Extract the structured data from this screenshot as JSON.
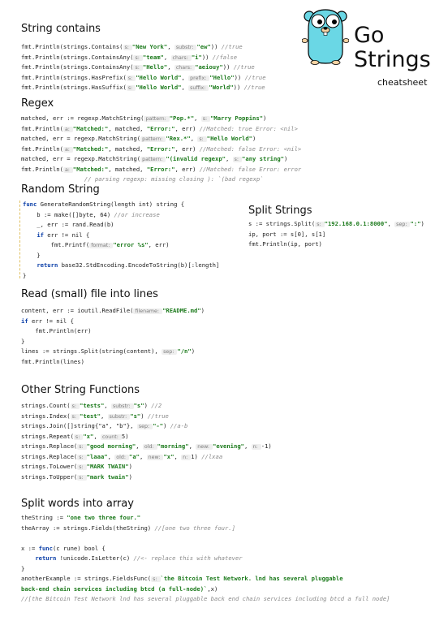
{
  "header": {
    "title_line1": "Go",
    "title_line2": "Strings",
    "subtitle": "cheatsheet"
  },
  "sections": {
    "contains": "String contains",
    "regex": "Regex",
    "random": "Random String",
    "split": "Split Strings",
    "readfile": "Read (small) file into lines",
    "other": "Other String Functions",
    "words": "Split words into array"
  },
  "colors": {
    "string": "#1c7a1c",
    "comment": "#8a8a8a",
    "keyword": "#0b3fa8",
    "hint_bg": "#efefef",
    "gopher": "#6ad7e5"
  },
  "icons": {
    "logo": "gopher-icon"
  },
  "code": {
    "contains": [
      [
        [
          "fmt.Println(strings.Contains(",
          ""
        ],
        [
          "s: ",
          "h"
        ],
        [
          "\"New York\"",
          "s"
        ],
        [
          ", ",
          ""
        ],
        [
          "substr: ",
          "h"
        ],
        [
          "\"ew\"",
          "s"
        ],
        [
          ")) ",
          ""
        ],
        [
          "//true",
          "c"
        ]
      ],
      [
        [
          "fmt.Println(strings.ContainsAny(",
          ""
        ],
        [
          "s: ",
          "h"
        ],
        [
          "\"team\"",
          "s"
        ],
        [
          ", ",
          ""
        ],
        [
          "chars: ",
          "h"
        ],
        [
          "\"i\"",
          "s"
        ],
        [
          ")) ",
          ""
        ],
        [
          "//false",
          "c"
        ]
      ],
      [
        [
          "fmt.Println(strings.ContainsAny(",
          ""
        ],
        [
          "s: ",
          "h"
        ],
        [
          "\"Hello\"",
          "s"
        ],
        [
          ", ",
          ""
        ],
        [
          "chars: ",
          "h"
        ],
        [
          "\"aeiouy\"",
          "s"
        ],
        [
          ")) ",
          ""
        ],
        [
          "//true",
          "c"
        ]
      ],
      [
        [
          "fmt.Println(strings.HasPrefix(",
          ""
        ],
        [
          "s: ",
          "h"
        ],
        [
          "\"Hello World\"",
          "s"
        ],
        [
          ", ",
          ""
        ],
        [
          "prefix: ",
          "h"
        ],
        [
          "\"Hello\"",
          "s"
        ],
        [
          ")) ",
          ""
        ],
        [
          "//true",
          "c"
        ]
      ],
      [
        [
          "fmt.Println(strings.HasSuffix(",
          ""
        ],
        [
          "s: ",
          "h"
        ],
        [
          "\"Hello World\"",
          "s"
        ],
        [
          ", ",
          ""
        ],
        [
          "suffix: ",
          "h"
        ],
        [
          "\"World\"",
          "s"
        ],
        [
          ")) ",
          ""
        ],
        [
          "//true",
          "c"
        ]
      ]
    ],
    "regex": [
      [
        [
          "matched, err := regexp.MatchString(",
          ""
        ],
        [
          "pattern: ",
          "h"
        ],
        [
          "\"Pop.*\"",
          "s"
        ],
        [
          ", ",
          ""
        ],
        [
          "s: ",
          "h"
        ],
        [
          "\"Marry Poppins\"",
          "s"
        ],
        [
          ")",
          ""
        ]
      ],
      [
        [
          "fmt.Println(",
          ""
        ],
        [
          "a: ",
          "h"
        ],
        [
          "\"Matched:\"",
          "s"
        ],
        [
          ", matched, ",
          ""
        ],
        [
          "\"Error:\"",
          "s"
        ],
        [
          ", err) ",
          ""
        ],
        [
          "//Matched: true Error: <nil>",
          "c"
        ]
      ],
      [
        [
          "matched, err = regexp.MatchString(",
          ""
        ],
        [
          "pattern: ",
          "h"
        ],
        [
          "\"Rex.*\"",
          "s"
        ],
        [
          ", ",
          ""
        ],
        [
          "s: ",
          "h"
        ],
        [
          "\"Hello World\"",
          "s"
        ],
        [
          ")",
          ""
        ]
      ],
      [
        [
          "fmt.Println(",
          ""
        ],
        [
          "a: ",
          "h"
        ],
        [
          "\"Matched:\"",
          "s"
        ],
        [
          ", matched, ",
          ""
        ],
        [
          "\"Error:\"",
          "s"
        ],
        [
          ", err) ",
          ""
        ],
        [
          "//Matched: false Error: <nil>",
          "c"
        ]
      ],
      [
        [
          "matched, err = regexp.MatchString(",
          ""
        ],
        [
          "pattern: ",
          "h"
        ],
        [
          "\"(invalid regexp\"",
          "s"
        ],
        [
          ", ",
          ""
        ],
        [
          "s: ",
          "h"
        ],
        [
          "\"any string\"",
          "s"
        ],
        [
          ")",
          ""
        ]
      ],
      [
        [
          "fmt.Println(",
          ""
        ],
        [
          "a: ",
          "h"
        ],
        [
          "\"Matched:\"",
          "s"
        ],
        [
          ", matched, ",
          ""
        ],
        [
          "\"Error:\"",
          "s"
        ],
        [
          ", err) ",
          ""
        ],
        [
          "//Matched: false Error: error",
          "c"
        ]
      ],
      [
        [
          "                  ",
          ""
        ],
        [
          "// parsing regexp: missing closing ): `(bad regexp`",
          "c"
        ]
      ]
    ],
    "random": [
      [
        [
          "func",
          "k"
        ],
        [
          " GenerateRandomString(length int) string {",
          ""
        ]
      ],
      [
        [
          "    b := make([]byte, 64) ",
          ""
        ],
        [
          "//or increase",
          "c"
        ]
      ],
      [
        [
          "    _, err := rand.Read(b)",
          ""
        ]
      ],
      [
        [
          "    ",
          ""
        ],
        [
          "if",
          "k"
        ],
        [
          " err != nil {",
          ""
        ]
      ],
      [
        [
          "        fmt.Printf(",
          ""
        ],
        [
          "format: ",
          "h"
        ],
        [
          "\"error %s\"",
          "s"
        ],
        [
          ", err)",
          ""
        ]
      ],
      [
        [
          "    }",
          ""
        ]
      ],
      [
        [
          "    ",
          ""
        ],
        [
          "return",
          "k"
        ],
        [
          " base32.StdEncoding.EncodeToString(b)[:length]",
          ""
        ]
      ],
      [
        [
          "}",
          ""
        ]
      ]
    ],
    "split": [
      [
        [
          "s := strings.Split(",
          ""
        ],
        [
          "s: ",
          "h"
        ],
        [
          "\"192.168.0.1:8000\"",
          "s"
        ],
        [
          ", ",
          ""
        ],
        [
          "sep: ",
          "h"
        ],
        [
          "\":\"",
          "s"
        ],
        [
          ")",
          ""
        ]
      ],
      [
        [
          "ip, port := s[0], s[1]",
          ""
        ]
      ],
      [
        [
          "fmt.Println(ip, port)",
          ""
        ]
      ]
    ],
    "readfile": [
      [
        [
          "content, err := ioutil.ReadFile(",
          ""
        ],
        [
          "filename: ",
          "h"
        ],
        [
          "\"README.md\"",
          "s"
        ],
        [
          ")",
          ""
        ]
      ],
      [
        [
          "if",
          "k"
        ],
        [
          " err != nil {",
          ""
        ]
      ],
      [
        [
          "    fmt.Println(err)",
          ""
        ]
      ],
      [
        [
          "}",
          ""
        ]
      ],
      [
        [
          "lines := strings.Split(string(content), ",
          ""
        ],
        [
          "sep: ",
          "h"
        ],
        [
          "\"/n\"",
          "s"
        ],
        [
          ")",
          ""
        ]
      ],
      [
        [
          "fmt.Println(lines)",
          ""
        ]
      ]
    ],
    "other": [
      [
        [
          "strings.Count(",
          ""
        ],
        [
          "s: ",
          "h"
        ],
        [
          "\"tests\"",
          "s"
        ],
        [
          ", ",
          ""
        ],
        [
          "substr: ",
          "h"
        ],
        [
          "\"s\"",
          "s"
        ],
        [
          ") ",
          ""
        ],
        [
          "//2",
          "c"
        ]
      ],
      [
        [
          "strings.Index(",
          ""
        ],
        [
          "s: ",
          "h"
        ],
        [
          "\"test\"",
          "s"
        ],
        [
          ", ",
          ""
        ],
        [
          "substr: ",
          "h"
        ],
        [
          "\"s\"",
          "s"
        ],
        [
          ") ",
          ""
        ],
        [
          "//true",
          "c"
        ]
      ],
      [
        [
          "strings.Join([]string{\"a\", \"b\"}, ",
          ""
        ],
        [
          "sep: ",
          "h"
        ],
        [
          "\"-\"",
          "s"
        ],
        [
          ") ",
          ""
        ],
        [
          "//a-b",
          "c"
        ]
      ],
      [
        [
          "strings.Repeat(",
          ""
        ],
        [
          "s: ",
          "h"
        ],
        [
          "\"x\"",
          "s"
        ],
        [
          ", ",
          ""
        ],
        [
          "count: ",
          "h"
        ],
        [
          "5",
          ""
        ],
        [
          ")",
          ""
        ]
      ],
      [
        [
          "strings.Replace(",
          ""
        ],
        [
          "s: ",
          "h"
        ],
        [
          "\"good morning\"",
          "s"
        ],
        [
          ", ",
          ""
        ],
        [
          "old: ",
          "h"
        ],
        [
          "\"morning\"",
          "s"
        ],
        [
          ", ",
          ""
        ],
        [
          "new: ",
          "h"
        ],
        [
          "\"evening\"",
          "s"
        ],
        [
          ", ",
          ""
        ],
        [
          "n: ",
          "h"
        ],
        [
          "-1)",
          ""
        ]
      ],
      [
        [
          "strings.Replace(",
          ""
        ],
        [
          "s: ",
          "h"
        ],
        [
          "\"laaa\"",
          "s"
        ],
        [
          ", ",
          ""
        ],
        [
          "old: ",
          "h"
        ],
        [
          "\"a\"",
          "s"
        ],
        [
          ", ",
          ""
        ],
        [
          "new: ",
          "h"
        ],
        [
          "\"x\"",
          "s"
        ],
        [
          ", ",
          ""
        ],
        [
          "n: ",
          "h"
        ],
        [
          "1) ",
          ""
        ],
        [
          "//lxaa",
          "c"
        ]
      ],
      [
        [
          "strings.ToLower(",
          ""
        ],
        [
          "s: ",
          "h"
        ],
        [
          "\"MARK TWAIN\"",
          "s"
        ],
        [
          ")",
          ""
        ]
      ],
      [
        [
          "strings.ToUpper(",
          ""
        ],
        [
          "s: ",
          "h"
        ],
        [
          "\"mark twain\"",
          "s"
        ],
        [
          ")",
          ""
        ]
      ]
    ],
    "words": [
      [
        [
          "theString := ",
          ""
        ],
        [
          "\"one two three four.\"",
          "s"
        ]
      ],
      [
        [
          "theArray := strings.Fields(theString) ",
          ""
        ],
        [
          "//[one two three four.]",
          "c"
        ]
      ],
      [
        [
          "",
          ""
        ]
      ],
      [
        [
          "x := ",
          ""
        ],
        [
          "func",
          "k"
        ],
        [
          "(c rune) bool {",
          ""
        ]
      ],
      [
        [
          "    ",
          ""
        ],
        [
          "return",
          "k"
        ],
        [
          " !unicode.IsLetter(c) ",
          ""
        ],
        [
          "//<- replace this with whatever",
          "c"
        ]
      ],
      [
        [
          "}",
          ""
        ]
      ],
      [
        [
          "anotherExample := strings.FieldsFunc(",
          ""
        ],
        [
          "s: ",
          "h"
        ],
        [
          "`the Bitcoin Test Network. lnd has several pluggable",
          "s"
        ]
      ],
      [
        [
          "back-end chain services including btcd (a full-node)`",
          "s"
        ],
        [
          ",x)",
          ""
        ]
      ],
      [
        [
          "//[the Bitcoin Test Network lnd has several pluggable back end chain services including btcd a full node]",
          "c"
        ]
      ]
    ]
  }
}
